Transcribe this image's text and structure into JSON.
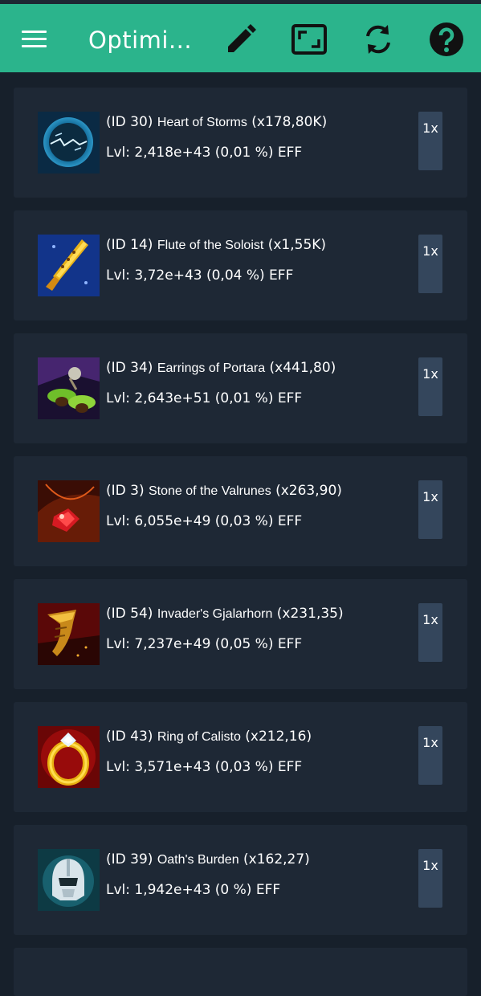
{
  "appbar": {
    "title": "Optimi...",
    "icons": [
      "menu-icon",
      "edit-pencil-icon",
      "fullscreen-icon",
      "refresh-icon",
      "help-icon"
    ],
    "color": "#2bb48c"
  },
  "items": [
    {
      "id_text": "(ID 30)",
      "name": "Heart of Storms",
      "mult": "(x178,80K)",
      "lvl": "Lvl: 2,418e+43 (0,01 %) EFF",
      "qty": "1x",
      "icon": "heart-of-storms-icon"
    },
    {
      "id_text": "(ID 14)",
      "name": "Flute of the Soloist",
      "mult": "(x1,55K)",
      "lvl": "Lvl: 3,72e+43 (0,04 %) EFF",
      "qty": "1x",
      "icon": "flute-of-the-soloist-icon"
    },
    {
      "id_text": "(ID 34)",
      "name": "Earrings of Portara",
      "mult": "(x441,80)",
      "lvl": "Lvl: 2,643e+51 (0,01 %) EFF",
      "qty": "1x",
      "icon": "earrings-of-portara-icon"
    },
    {
      "id_text": "(ID 3)",
      "name": "Stone of the Valrunes",
      "mult": "(x263,90)",
      "lvl": "Lvl: 6,055e+49 (0,03 %) EFF",
      "qty": "1x",
      "icon": "stone-of-the-valrunes-icon"
    },
    {
      "id_text": "(ID 54)",
      "name": "Invader's Gjalarhorn",
      "mult": "(x231,35)",
      "lvl": "Lvl: 7,237e+49 (0,05 %) EFF",
      "qty": "1x",
      "icon": "invaders-gjalarhorn-icon"
    },
    {
      "id_text": "(ID 43)",
      "name": "Ring of Calisto",
      "mult": "(x212,16)",
      "lvl": "Lvl: 3,571e+43 (0,03 %) EFF",
      "qty": "1x",
      "icon": "ring-of-calisto-icon"
    },
    {
      "id_text": "(ID 39)",
      "name": "Oath's Burden",
      "mult": "(x162,27)",
      "lvl": "Lvl: 1,942e+43 (0 %) EFF",
      "qty": "1x",
      "icon": "oaths-burden-icon"
    }
  ]
}
